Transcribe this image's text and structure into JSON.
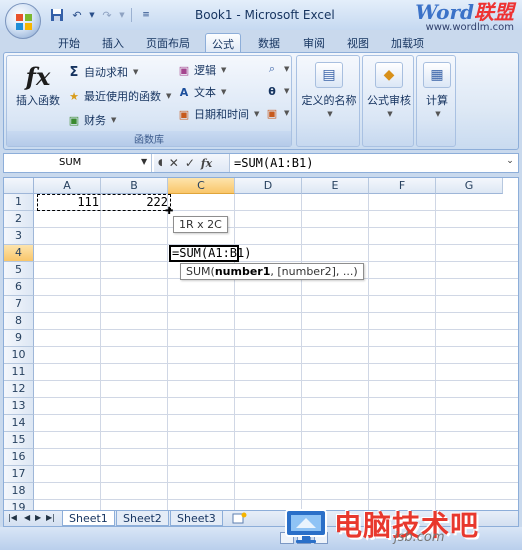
{
  "window": {
    "title": "Book1 - Microsoft Excel",
    "watermark_brand": "Word联盟",
    "watermark_url": "www.wordlm.com"
  },
  "qat": {
    "icons": [
      "save-icon",
      "undo-icon",
      "redo-icon",
      "customize-icon"
    ]
  },
  "tabs": [
    "开始",
    "插入",
    "页面布局",
    "公式",
    "数据",
    "审阅",
    "视图",
    "加载项"
  ],
  "active_tab": "公式",
  "ribbon": {
    "function_library": {
      "label": "函数库",
      "insert_function": "插入函数",
      "autosum": "自动求和",
      "recently_used": "最近使用的函数",
      "financial": "财务",
      "logical": "逻辑",
      "text": "文本",
      "date_time": "日期和时间"
    },
    "defined_names": "定义的名称",
    "formula_auditing": "公式审核",
    "calculation": "计算"
  },
  "formula_bar": {
    "name_box": "SUM",
    "formula": "=SUM(A1:B1)"
  },
  "grid": {
    "columns": [
      "A",
      "B",
      "C",
      "D",
      "E",
      "F",
      "G"
    ],
    "rows": [
      "1",
      "2",
      "3",
      "4",
      "5",
      "6",
      "7",
      "8",
      "9",
      "10",
      "11",
      "12",
      "13",
      "14",
      "15",
      "16",
      "17",
      "18",
      "19"
    ],
    "cells": {
      "A1": "111",
      "B1": "222"
    },
    "active_cell_text": "=SUM(A1:B1)",
    "selection_tip": "1R x 2C",
    "function_tip_name": "SUM(",
    "function_tip_arg1": "number1",
    "function_tip_rest": ", [number2], ...)"
  },
  "sheets": [
    "Sheet1",
    "Sheet2",
    "Sheet3"
  ],
  "active_sheet": "Sheet1",
  "footer_watermark": {
    "text": "电脑技术吧",
    "sub": "jsb.com"
  },
  "colors": {
    "ribbon_blue": "#dde8f5",
    "selected_header": "#f9c66a",
    "watermark_red": "#e8382d"
  }
}
